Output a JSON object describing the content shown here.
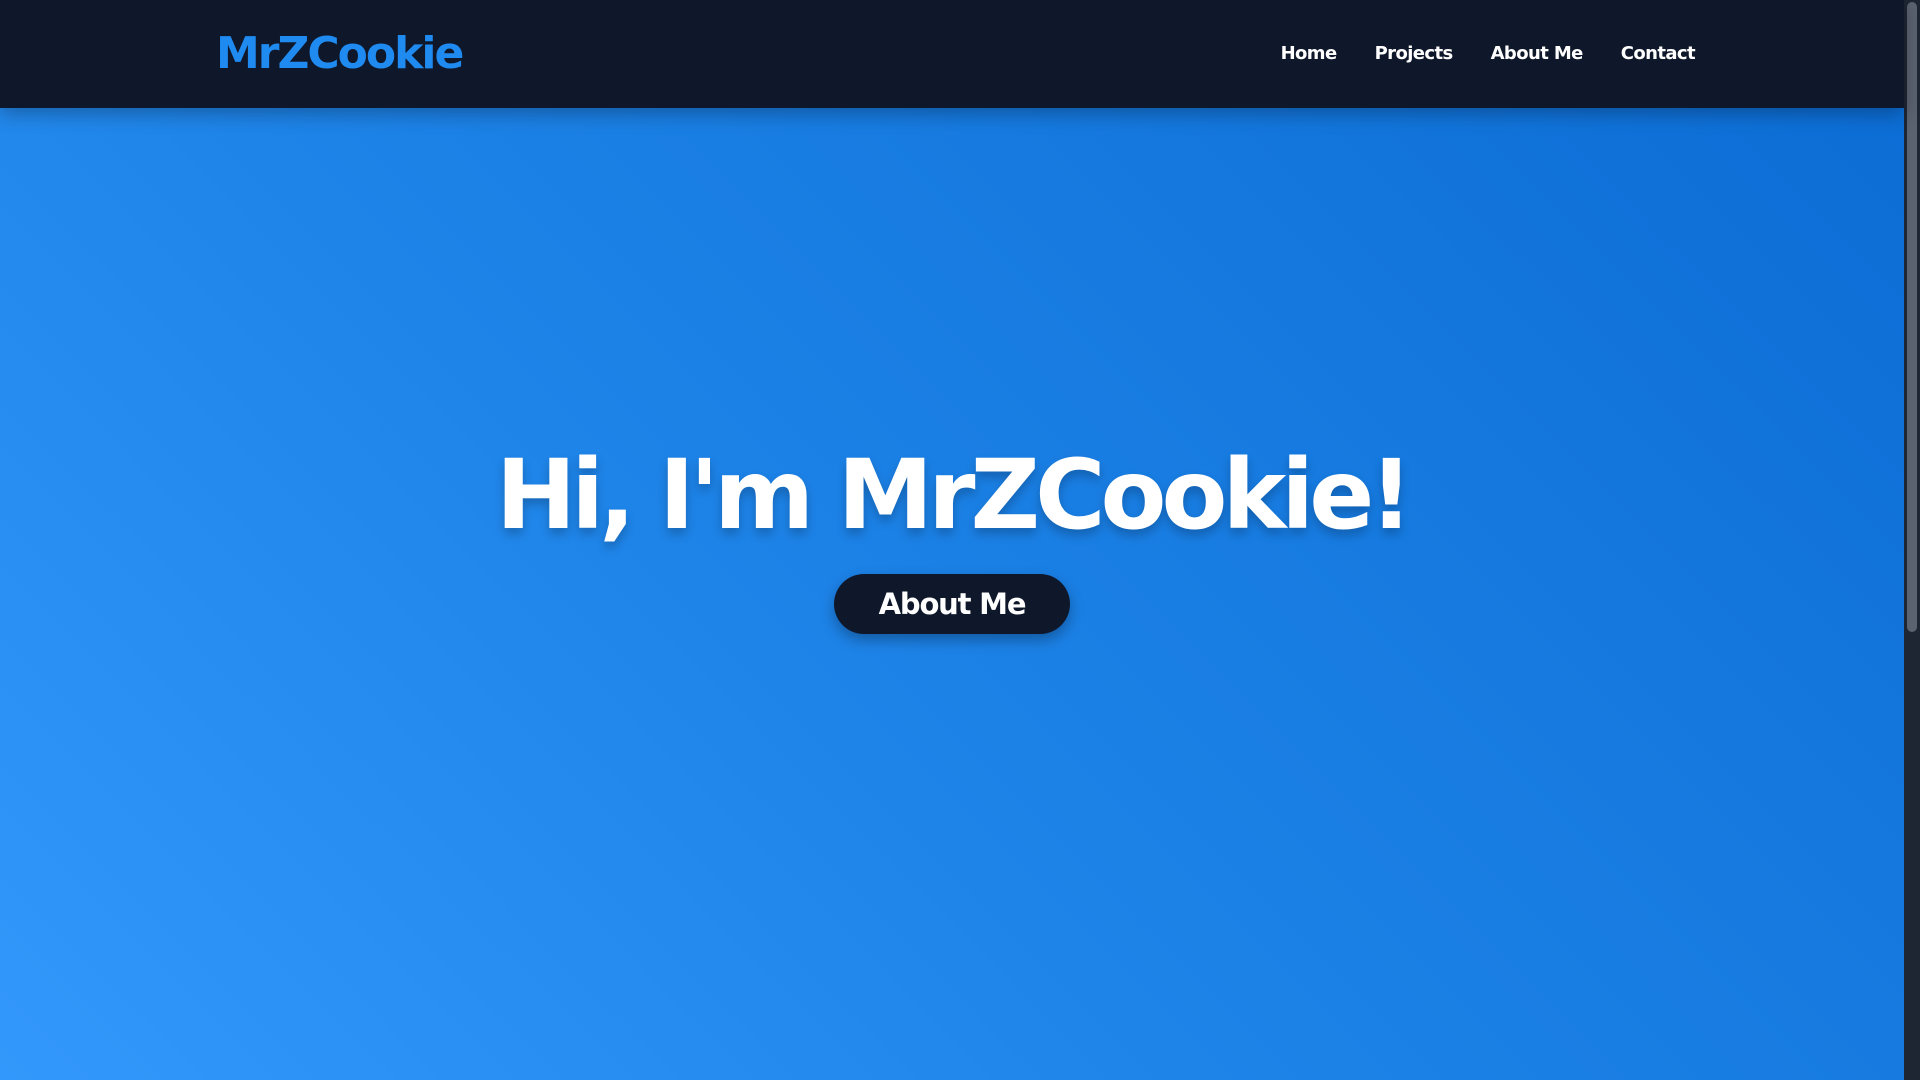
{
  "navbar": {
    "brand": "MrZCookie",
    "links": [
      {
        "label": "Home"
      },
      {
        "label": "Projects"
      },
      {
        "label": "About Me"
      },
      {
        "label": "Contact"
      }
    ]
  },
  "hero": {
    "title": "Hi, I'm MrZCookie!",
    "cta_label": "About Me"
  },
  "colors": {
    "navbar_bg": "#0f172a",
    "brand": "#1f8af0",
    "hero_gradient_start": "#3398fb",
    "hero_gradient_end": "#0b6cd4",
    "button_bg": "#0f172a",
    "text": "#ffffff"
  }
}
